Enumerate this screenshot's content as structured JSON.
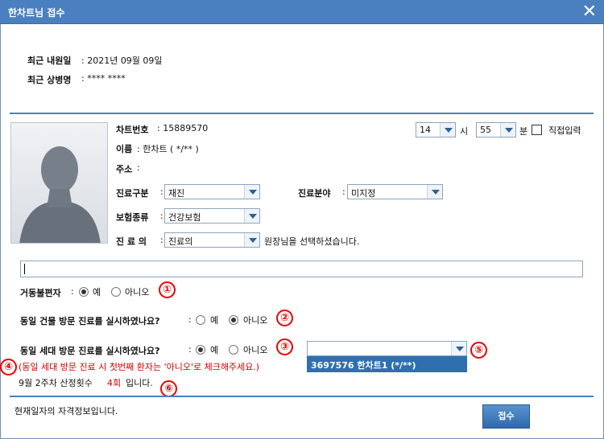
{
  "window": {
    "title": "한차트님 접수",
    "close_icon": "close-icon"
  },
  "recent": {
    "visit_label": "최근 내원일",
    "visit_value": ": 2021년 09월 09일",
    "disease_label": "최근 상병명",
    "disease_value": ": **** ****"
  },
  "patient": {
    "chart_no_label": "차트번호",
    "chart_no_value": ": 15889570",
    "name_label": "이름",
    "name_value": ": 한차트 ( */** )",
    "address_label": "주소",
    "address_value": ":",
    "visit_type_label": "진료구분",
    "visit_type_value": "재진",
    "department_label": "진료분야",
    "department_value": "미지정",
    "insurance_label": "보험종류",
    "insurance_value": "건강보험",
    "doctor_label": "진 료 의",
    "doctor_value": "진료의",
    "doctor_note": "원장님을 선택하셨습니다."
  },
  "time": {
    "hour_value": "14",
    "hour_unit": "시",
    "minute_value": "55",
    "minute_unit": "분",
    "manual_label": "직접입력"
  },
  "questions": {
    "mobility_label": "거동불편자",
    "building_label": "동일 건물 방문 진료를 실시하였나요?",
    "household_label": "동일 세대 방문 진료를 실시하였나요?",
    "yes": "예",
    "no": "아니오",
    "colon": ":"
  },
  "household": {
    "hint": "(동일 세대 방문 진료 시 첫번째 환자는 '아니오'로 체크해주세요.)",
    "list_item": "3697576   한차트1 (*/**)",
    "week_text_prefix": "9월 2주차 산정횟수",
    "week_count": "4회",
    "week_text_suffix": "입니다."
  },
  "markers": [
    "①",
    "②",
    "③",
    "④",
    "⑤",
    "⑥"
  ],
  "footer": {
    "status": "현재일자의 자격정보입니다.",
    "submit_label": "접수"
  },
  "colors": {
    "title_bar": "#4a80bf",
    "divider": "#4a80bf",
    "marker": "#e00000",
    "submit": "#3a78b9"
  }
}
